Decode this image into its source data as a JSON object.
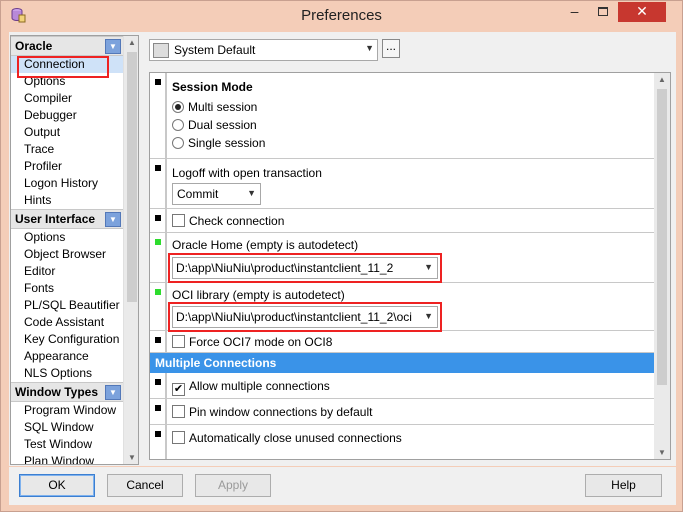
{
  "window": {
    "title": "Preferences",
    "minimize_glyph": "–",
    "close_glyph": "✕",
    "icon": "database-app-icon"
  },
  "nav": {
    "groups": [
      {
        "title": "Oracle",
        "items": [
          "Connection",
          "Options",
          "Compiler",
          "Debugger",
          "Output",
          "Trace",
          "Profiler",
          "Logon History",
          "Hints"
        ]
      },
      {
        "title": "User Interface",
        "items": [
          "Options",
          "Object Browser",
          "Editor",
          "Fonts",
          "PL/SQL Beautifier",
          "Code Assistant",
          "Key Configuration",
          "Appearance",
          "NLS Options"
        ]
      },
      {
        "title": "Window Types",
        "items": [
          "Program Window",
          "SQL Window",
          "Test Window",
          "Plan Window"
        ]
      }
    ],
    "selected": "Connection"
  },
  "profile": {
    "value": "System Default",
    "more_label": "..."
  },
  "settings": {
    "session_mode": {
      "title": "Session Mode",
      "options": [
        "Multi session",
        "Dual session",
        "Single session"
      ],
      "selected": "Multi session"
    },
    "logoff": {
      "label": "Logoff with open transaction",
      "value": "Commit"
    },
    "check_connection": {
      "label": "Check connection",
      "checked": false
    },
    "oracle_home": {
      "label": "Oracle Home (empty is autodetect)",
      "value": "D:\\app\\NiuNiu\\product\\instantclient_11_2"
    },
    "oci_library": {
      "label": "OCI library (empty is autodetect)",
      "value": "D:\\app\\NiuNiu\\product\\instantclient_11_2\\oci"
    },
    "force_oci7": {
      "label": "Force OCI7 mode on OCI8",
      "checked": false
    },
    "multiple_connections": {
      "title": "Multiple Connections",
      "allow": {
        "label": "Allow multiple connections",
        "checked": true
      },
      "pin": {
        "label": "Pin window connections by default",
        "checked": false
      },
      "auto_close": {
        "label": "Automatically close unused connections",
        "checked": false
      }
    }
  },
  "buttons": {
    "ok": "OK",
    "cancel": "Cancel",
    "apply": "Apply",
    "help": "Help"
  },
  "glyphs": {
    "check": "✔",
    "arrow_down": "▼",
    "arrow_up": "▲"
  },
  "colors": {
    "title_bg": "#f4cdb8",
    "accent_blue": "#3a93e8",
    "close_red": "#c7372f",
    "highlight_red": "#e22222",
    "modified_green": "#2ddc2d"
  }
}
